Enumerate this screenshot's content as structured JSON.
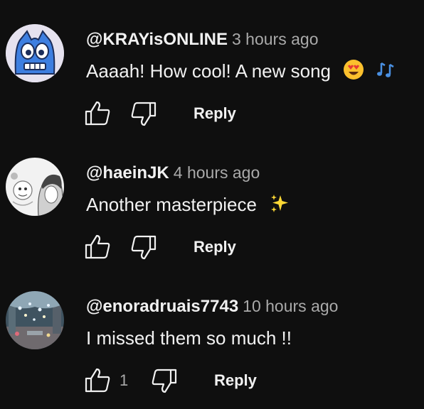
{
  "comments": [
    {
      "handle": "@KRAYisONLINE",
      "time": "3 hours ago",
      "text": "Aaaah! How cool! A new song",
      "emojis": [
        "heart-eyes-emoji",
        "musical-notes-emoji"
      ],
      "like_count": "",
      "reply_label": "Reply",
      "avatar": "blue-cartoon-monster-avatar"
    },
    {
      "handle": "@haeinJK",
      "time": "4 hours ago",
      "text": "Another masterpiece",
      "emojis": [
        "sparkles-emoji"
      ],
      "like_count": "",
      "reply_label": "Reply",
      "avatar": "manga-sketch-avatar"
    },
    {
      "handle": "@enoradruais7743",
      "time": "10 hours ago",
      "text": "I missed them so much !!",
      "emojis": [],
      "like_count": "1",
      "reply_label": "Reply",
      "avatar": "night-street-lights-avatar"
    }
  ],
  "colors": {
    "background": "#0f0f0f",
    "text": "#f1f1f1",
    "secondary": "#aaaaaa",
    "avatar_blue": "#3e7fe0"
  }
}
